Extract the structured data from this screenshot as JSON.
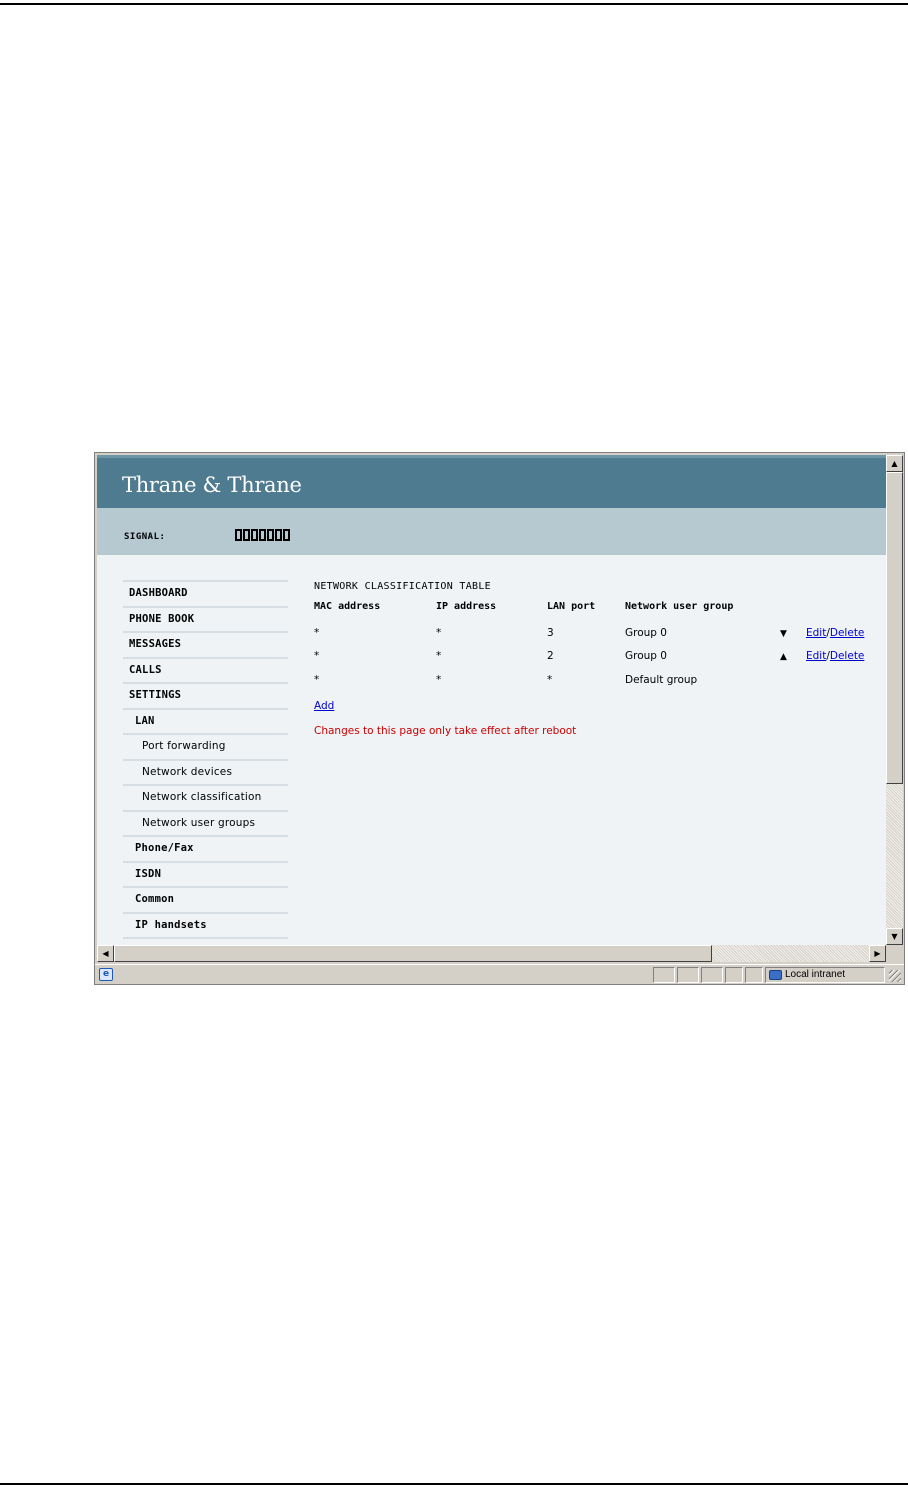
{
  "header": {
    "logo": "Thrane & Thrane"
  },
  "signal": {
    "label": "SIGNAL:",
    "segments": 7
  },
  "sidebar": {
    "items": [
      {
        "label": "DASHBOARD",
        "level": 0
      },
      {
        "label": "PHONE BOOK",
        "level": 0
      },
      {
        "label": "MESSAGES",
        "level": 0
      },
      {
        "label": "CALLS",
        "level": 0
      },
      {
        "label": "SETTINGS",
        "level": 0
      },
      {
        "label": "LAN",
        "level": 1
      },
      {
        "label": "Port forwarding",
        "level": 2
      },
      {
        "label": "Network devices",
        "level": 2
      },
      {
        "label": "Network classification",
        "level": 2
      },
      {
        "label": "Network user groups",
        "level": 2
      },
      {
        "label": "Phone/Fax",
        "level": 1
      },
      {
        "label": "ISDN",
        "level": 1
      },
      {
        "label": "Common",
        "level": 1
      },
      {
        "label": "IP handsets",
        "level": 1
      }
    ]
  },
  "main": {
    "title": "NETWORK CLASSIFICATION TABLE",
    "columns": [
      "MAC address",
      "IP address",
      "LAN port",
      "Network user group"
    ],
    "rows": [
      {
        "mac": "*",
        "ip": "*",
        "port": "3",
        "group": "Group 0",
        "arrow": "▼",
        "edit": "Edit",
        "sep": "/",
        "delete": "Delete"
      },
      {
        "mac": "*",
        "ip": "*",
        "port": "2",
        "group": "Group 0",
        "arrow": "▲",
        "edit": "Edit",
        "sep": "/",
        "delete": "Delete"
      },
      {
        "mac": "*",
        "ip": "*",
        "port": "*",
        "group": "Default group",
        "arrow": "",
        "edit": "",
        "sep": "",
        "delete": ""
      }
    ],
    "add_label": "Add",
    "notice": "Changes to this page only take effect after reboot",
    "notice_color": "#cc0000",
    "link_color": "#0000cc"
  },
  "statusbar": {
    "zone": "Local intranet"
  },
  "colors": {
    "header": "#4e7b90",
    "signal_band": "#b6c9d1",
    "page_bg": "#eff3f6"
  }
}
